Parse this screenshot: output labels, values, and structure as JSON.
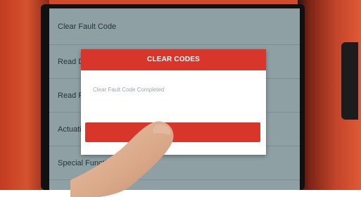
{
  "menu": {
    "items": [
      {
        "label": "Clear Fault Code"
      },
      {
        "label": "Read Data Stream"
      },
      {
        "label": "Read Freeze Frame"
      },
      {
        "label": "Actuation Test"
      },
      {
        "label": "Special Function"
      }
    ]
  },
  "dialog": {
    "title": "CLEAR CODES",
    "message": "Clear Fault Code Completed",
    "button_label": ""
  },
  "colors": {
    "accent": "#d8352b",
    "screen_background": "#8fa0a4",
    "device_body": "#d24a2c"
  }
}
